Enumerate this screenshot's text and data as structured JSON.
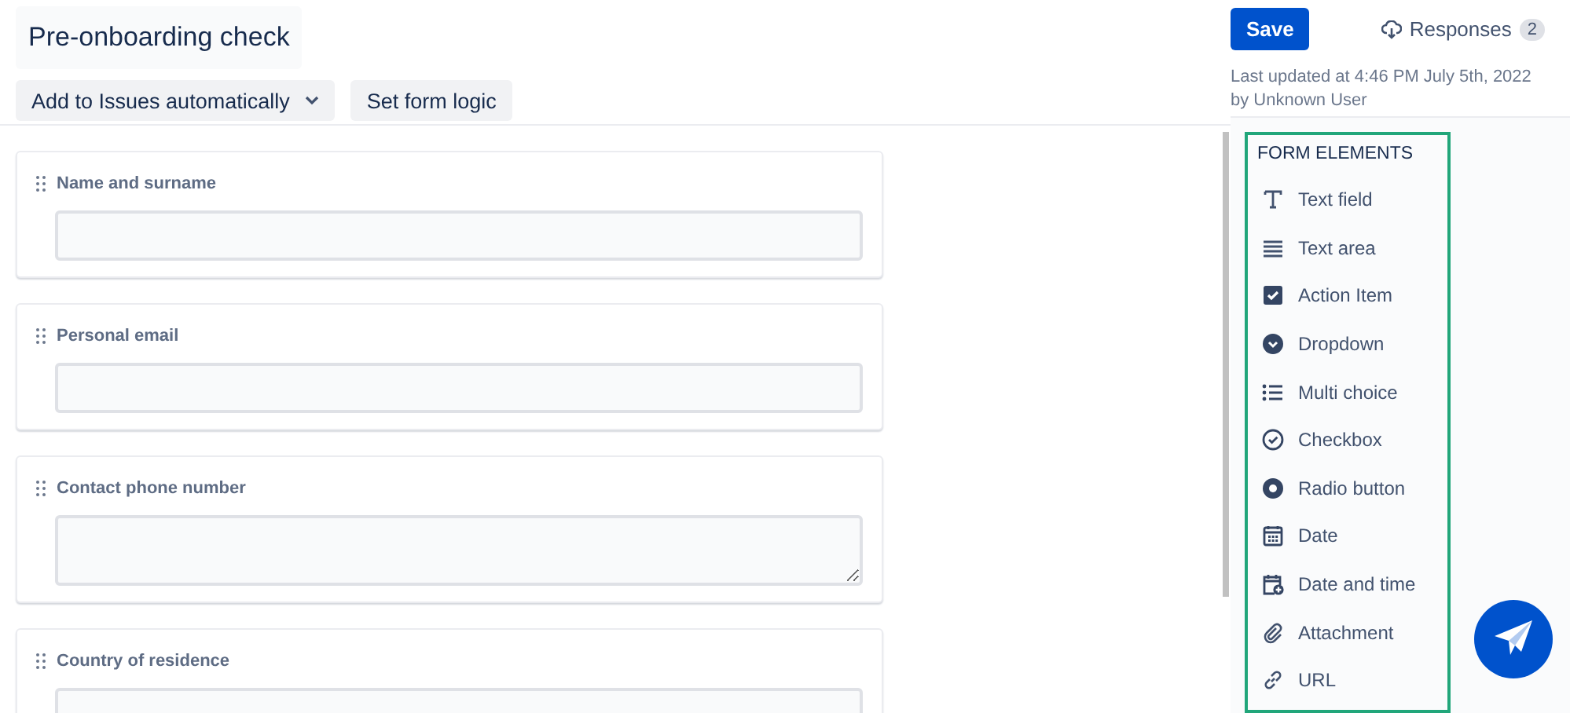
{
  "form": {
    "title": "Pre-onboarding check",
    "toolbar": [
      {
        "label": "Add to Issues automatically",
        "kind": "dropdown"
      },
      {
        "label": "Set form logic",
        "kind": "button"
      }
    ]
  },
  "header": {
    "save": "Save",
    "responses": {
      "label": "Responses",
      "count": "2"
    },
    "updated": "Last updated at 4:46 PM July 5th, 2022",
    "updated_by": "by Unknown User"
  },
  "fields": [
    {
      "label": "Name and surname",
      "kind": "input"
    },
    {
      "label": "Personal email",
      "kind": "input"
    },
    {
      "label": "Contact phone number",
      "kind": "textarea"
    },
    {
      "label": "Country of residence",
      "kind": "input"
    }
  ],
  "form_elements": {
    "title": "FORM ELEMENTS",
    "items": [
      {
        "label": "Text field",
        "kind": "text"
      },
      {
        "label": "Text area",
        "kind": "lines"
      },
      {
        "label": "Action Item",
        "kind": "check-square"
      },
      {
        "label": "Dropdown",
        "kind": "chevron-circle"
      },
      {
        "label": "Multi choice",
        "kind": "list"
      },
      {
        "label": "Checkbox",
        "kind": "check-circle"
      },
      {
        "label": "Radio button",
        "kind": "radio"
      },
      {
        "label": "Date",
        "kind": "calendar"
      },
      {
        "label": "Date and time",
        "kind": "calendar-plus"
      },
      {
        "label": "Attachment",
        "kind": "paperclip"
      },
      {
        "label": "URL",
        "kind": "link"
      }
    ]
  }
}
